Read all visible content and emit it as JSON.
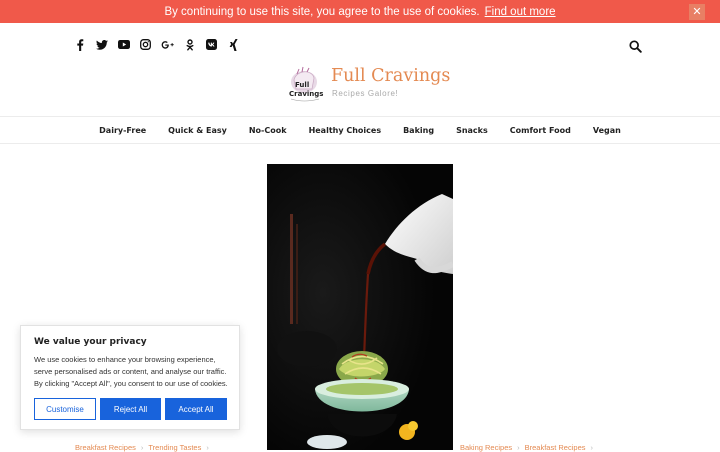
{
  "notice": {
    "text": "By continuing to use this site, you agree to the use of cookies.",
    "link": "Find out more",
    "close_glyph": "✕"
  },
  "header": {
    "social_icons": [
      "facebook-icon",
      "twitter-icon",
      "youtube-icon",
      "instagram-icon",
      "google-plus-icon",
      "odnoklassniki-icon",
      "vk-icon",
      "xing-icon"
    ],
    "logo_title": "Full Cravings",
    "logo_tagline": "Recipes Galore!",
    "logo_mark_line1": "Full",
    "logo_mark_line2": "Cravings"
  },
  "nav": {
    "items": [
      "Dairy-Free",
      "Quick & Easy",
      "No-Cook",
      "Healthy Choices",
      "Baking",
      "Snacks",
      "Comfort Food",
      "Vegan"
    ]
  },
  "posts": {
    "left_meta": [
      "Breakfast Recipes",
      "Trending Tastes"
    ],
    "right_meta": [
      "Baking Recipes",
      "Breakfast Recipes"
    ],
    "separator": "›"
  },
  "privacy": {
    "heading": "We value your privacy",
    "body": "We use cookies to enhance your browsing experience, serve personalised ads or content, and analyse our traffic. By clicking \"Accept All\", you consent to our use of cookies.",
    "customise": "Customise",
    "reject": "Reject All",
    "accept": "Accept All"
  },
  "colors": {
    "notice_bg": "#f0594a",
    "accent": "#e48a52",
    "cookie_blue": "#1863dc"
  }
}
